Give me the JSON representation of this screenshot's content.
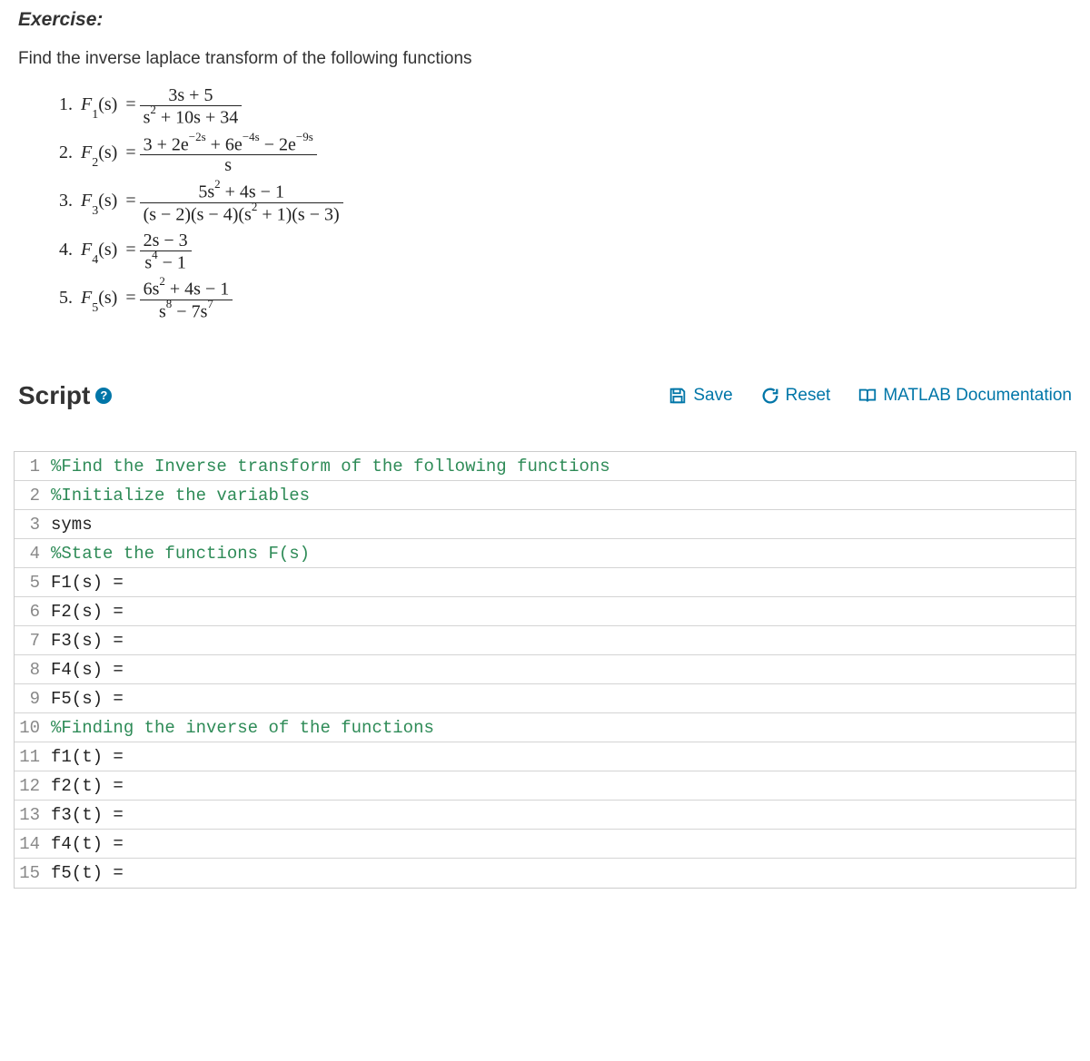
{
  "exercise_title": "Exercise:",
  "instruction": "Find the inverse laplace transform of the following functions",
  "math": {
    "items": [
      {
        "label": "1.",
        "func": "F",
        "sub": "1",
        "arg": "(s)",
        "eq": "=",
        "num": "3s + 5",
        "den_html": "s<sup>2</sup> + 10s + 34"
      },
      {
        "label": "2.",
        "func": "F",
        "sub": "2",
        "arg": "(s)",
        "eq": "=",
        "num_html": "3 + 2e<sup>−2s</sup> + 6e<sup>−4s</sup> − 2e<sup>−9s</sup>",
        "den": "s"
      },
      {
        "label": "3.",
        "func": "F",
        "sub": "3",
        "arg": "(s)",
        "eq": "=",
        "num_html": "5s<sup>2</sup> + 4s − 1",
        "den_html": "(s − 2)(s − 4)(s<sup>2</sup> + 1)(s − 3)"
      },
      {
        "label": "4.",
        "func": "F",
        "sub": "4",
        "arg": "(s)",
        "eq": "=",
        "num": "2s − 3",
        "den_html": "s<sup>4</sup> − 1"
      },
      {
        "label": "5.",
        "func": "F",
        "sub": "5",
        "arg": "(s)",
        "eq": "=",
        "num_html": "6s<sup>2</sup> + 4s − 1",
        "den_html": "s<sup>8</sup> − 7s<sup>7</sup>"
      }
    ]
  },
  "script_heading": "Script",
  "toolbar": {
    "save_label": "Save",
    "reset_label": "Reset",
    "doc_label": "MATLAB Documentation"
  },
  "editor_lines": [
    {
      "n": "1",
      "cls": "cm-comment",
      "text": "%Find the Inverse transform of the following functions"
    },
    {
      "n": "2",
      "cls": "cm-comment",
      "text": "%Initialize the variables"
    },
    {
      "n": "3",
      "cls": "cm-plain",
      "text": "syms"
    },
    {
      "n": "4",
      "cls": "cm-comment",
      "text": "%State the functions F(s)"
    },
    {
      "n": "5",
      "cls": "cm-plain",
      "text": "F1(s) ="
    },
    {
      "n": "6",
      "cls": "cm-plain",
      "text": "F2(s) ="
    },
    {
      "n": "7",
      "cls": "cm-plain",
      "text": "F3(s) ="
    },
    {
      "n": "8",
      "cls": "cm-plain",
      "text": "F4(s) ="
    },
    {
      "n": "9",
      "cls": "cm-plain",
      "text": "F5(s) ="
    },
    {
      "n": "10",
      "cls": "cm-comment",
      "text": "%Finding the inverse of the functions"
    },
    {
      "n": "11",
      "cls": "cm-plain",
      "text": "f1(t) ="
    },
    {
      "n": "12",
      "cls": "cm-plain",
      "text": "f2(t) ="
    },
    {
      "n": "13",
      "cls": "cm-plain",
      "text": "f3(t) ="
    },
    {
      "n": "14",
      "cls": "cm-plain",
      "text": "f4(t) ="
    },
    {
      "n": "15",
      "cls": "cm-plain",
      "text": "f5(t) ="
    }
  ]
}
